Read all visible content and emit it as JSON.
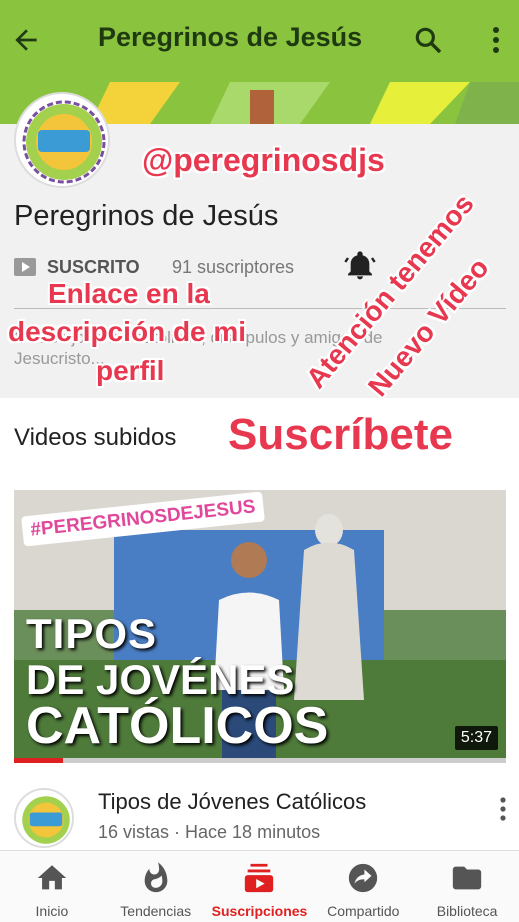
{
  "appbar": {
    "title": "Peregrinos de Jesús",
    "back_icon": "arrow-back-icon",
    "search_icon": "search-icon",
    "more_icon": "more-vert-icon",
    "color": "#8ac43f"
  },
  "channel": {
    "name": "Peregrinos de Jesús",
    "subscribe_status": "SUSCRITO",
    "subscriber_count": "91 suscriptores",
    "description": "Somos jóvenes católicos, discípulos y amigos de Jesucristo...",
    "logo_text": "PEREGRINOS DE JESÚS"
  },
  "overlays": {
    "handle": "@peregrinosdjs",
    "link_line1": "Enlace en la",
    "link_line2": "descripción de mi",
    "link_line3": "perfil",
    "attention_line1": "Atención tenemos",
    "attention_line2": "Nuevo Vídeo",
    "subscribe": "Suscríbete",
    "color": "#e8384f"
  },
  "section": {
    "title": "Videos subidos"
  },
  "video": {
    "hashtag": "#PEREGRINOSDEJESUS",
    "thumb_line1": "TIPOS",
    "thumb_line2": "DE JOVÉNES",
    "thumb_line3": "CATÓLICOS",
    "duration": "5:37",
    "watched_fraction": 0.1,
    "title": "Tipos de Jóvenes Católicos",
    "meta": "16 vistas · Hace 18 minutos"
  },
  "bottom_nav": [
    {
      "label": "Inicio",
      "icon": "home-icon"
    },
    {
      "label": "Tendencias",
      "icon": "flame-icon"
    },
    {
      "label": "Suscripciones",
      "icon": "subscriptions-icon",
      "active": true
    },
    {
      "label": "Compartido",
      "icon": "share-icon"
    },
    {
      "label": "Biblioteca",
      "icon": "folder-icon"
    }
  ]
}
